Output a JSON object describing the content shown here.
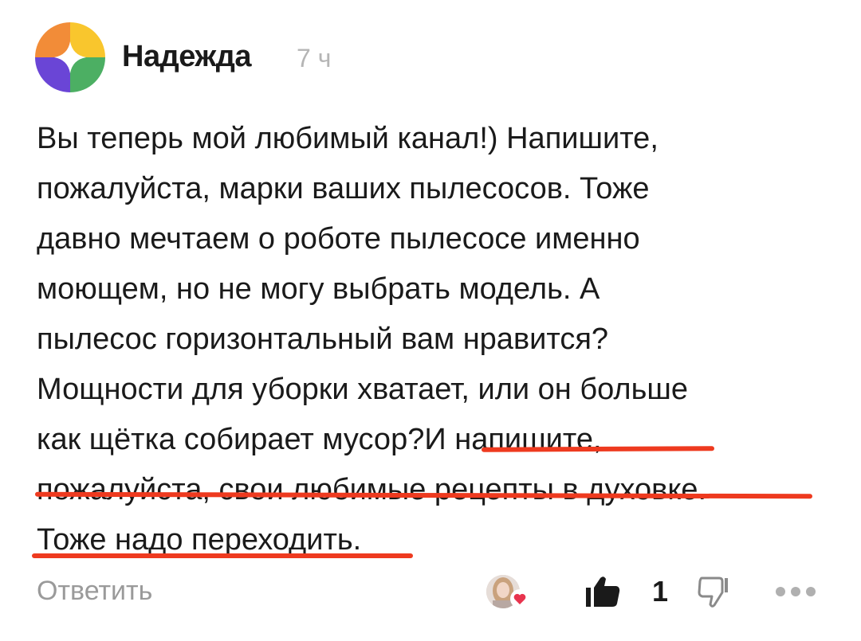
{
  "comment": {
    "author": "Надежда",
    "time": "7 ч",
    "lines": [
      "Вы теперь мой любимый канал!) Напишите,",
      "пожалуйста, марки ваших пылесосов. Тоже",
      "давно мечтаем о роботе пылесосе именно",
      "моющем, но не могу выбрать модель. А",
      "пылесос горизонтальный вам нравится?",
      "Мощности для уборки хватает, или он больше",
      "как щётка собирает мусор?И напишите,",
      "пожалуйста, свои любимые рецепты в духовке.",
      "Тоже надо переходить."
    ]
  },
  "footer": {
    "reply_label": "Ответить",
    "like_count": "1"
  },
  "icons": {
    "author_avatar": "multicolor-pinwheel-logo",
    "liker_avatar": "user-photo-avatar",
    "heart": "heart-icon",
    "like": "thumbs-up-icon",
    "dislike": "thumbs-down-icon",
    "more": "more-dots-icon"
  },
  "colors": {
    "highlight_underline": "#ee3a1f",
    "muted_text": "#9a9a9a",
    "timestamp": "#b5b5b5",
    "logo_orange": "#f28c38",
    "logo_yellow": "#f9c62d",
    "logo_purple": "#6a45d6",
    "logo_green": "#4caf63",
    "heart": "#e8344e"
  }
}
